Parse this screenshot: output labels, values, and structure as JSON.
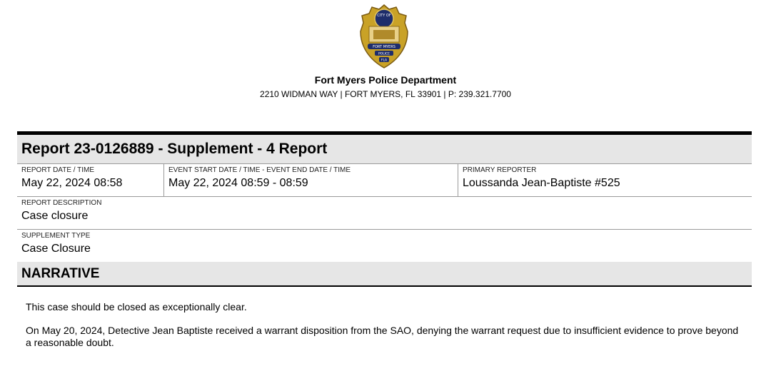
{
  "header": {
    "badge": {
      "top_text": "CITY OF",
      "middle_text": "FORT MYERS",
      "lower_text": "POLICE",
      "bottom_text": "FLA",
      "gold": "#c9a227",
      "dark_gold": "#7a5a12",
      "navy": "#1e2d6b"
    },
    "department": "Fort Myers Police Department",
    "address": "2210 WIDMAN WAY | FORT MYERS, FL 33901 | P: 239.321.7700"
  },
  "report": {
    "title": "Report 23-0126889 - Supplement - 4 Report",
    "report_datetime_label": "REPORT DATE / TIME",
    "report_datetime": "May 22, 2024 08:58",
    "event_datetime_label": "EVENT START DATE / TIME - EVENT END DATE / TIME",
    "event_datetime": "May 22, 2024 08:59 - 08:59",
    "primary_reporter_label": "PRIMARY REPORTER",
    "primary_reporter": "Loussanda Jean-Baptiste #525",
    "description_label": "REPORT DESCRIPTION",
    "description": "Case closure",
    "supplement_type_label": "SUPPLEMENT TYPE",
    "supplement_type": "Case Closure"
  },
  "narrative": {
    "heading": "NARRATIVE",
    "paragraphs": [
      "This case should be closed as exceptionally clear.",
      "On May 20, 2024, Detective Jean Baptiste received a warrant disposition from the SAO, denying the warrant request due to insufficient evidence to prove beyond a reasonable doubt."
    ]
  }
}
